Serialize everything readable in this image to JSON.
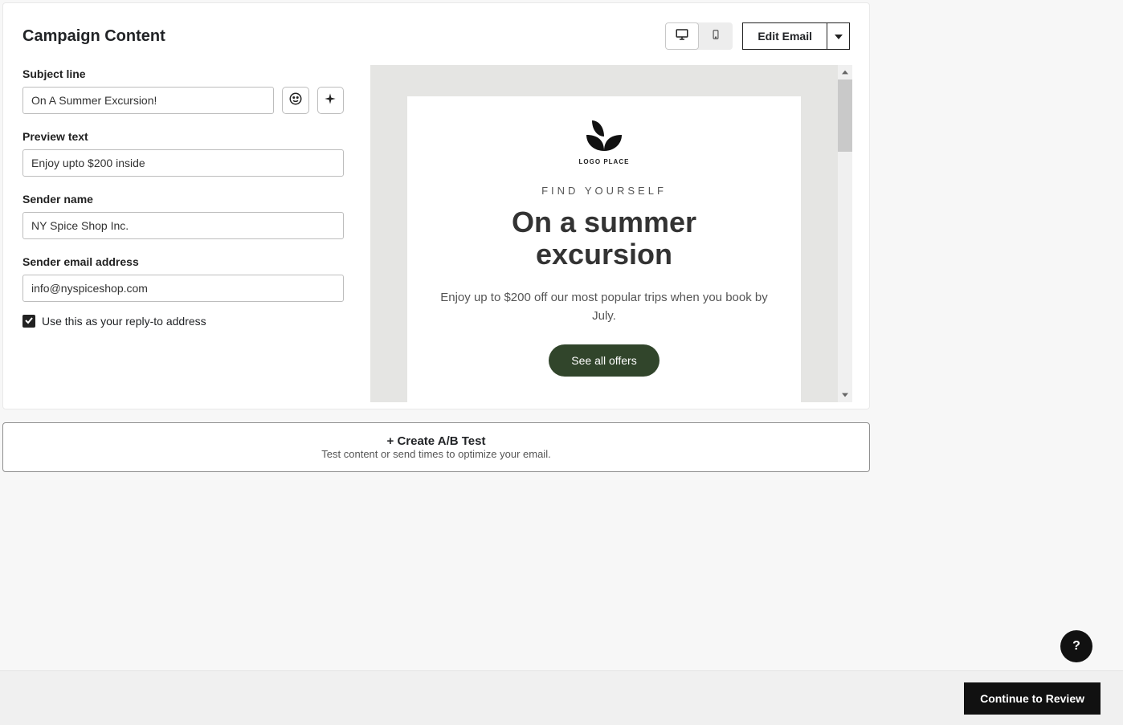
{
  "card": {
    "title": "Campaign Content",
    "edit_label": "Edit Email"
  },
  "form": {
    "subject_label": "Subject line",
    "subject_value": "On A Summer Excursion!",
    "preview_label": "Preview text",
    "preview_value": "Enjoy upto $200 inside",
    "sender_name_label": "Sender name",
    "sender_name_value": "NY Spice Shop Inc.",
    "sender_email_label": "Sender email address",
    "sender_email_value": "info@nyspiceshop.com",
    "replyto_label": "Use this as your reply-to address"
  },
  "preview": {
    "logo_caption": "LOGO PLACE",
    "eyebrow": "FIND YOURSELF",
    "title": "On a summer excursion",
    "body": "Enjoy up to $200 off our most popular trips when you book by July.",
    "cta": "See all offers"
  },
  "abtest": {
    "title": "+ Create A/B Test",
    "subtitle": "Test content or send times to optimize your email."
  },
  "footer": {
    "continue": "Continue to Review"
  },
  "help": {
    "label": "?"
  }
}
